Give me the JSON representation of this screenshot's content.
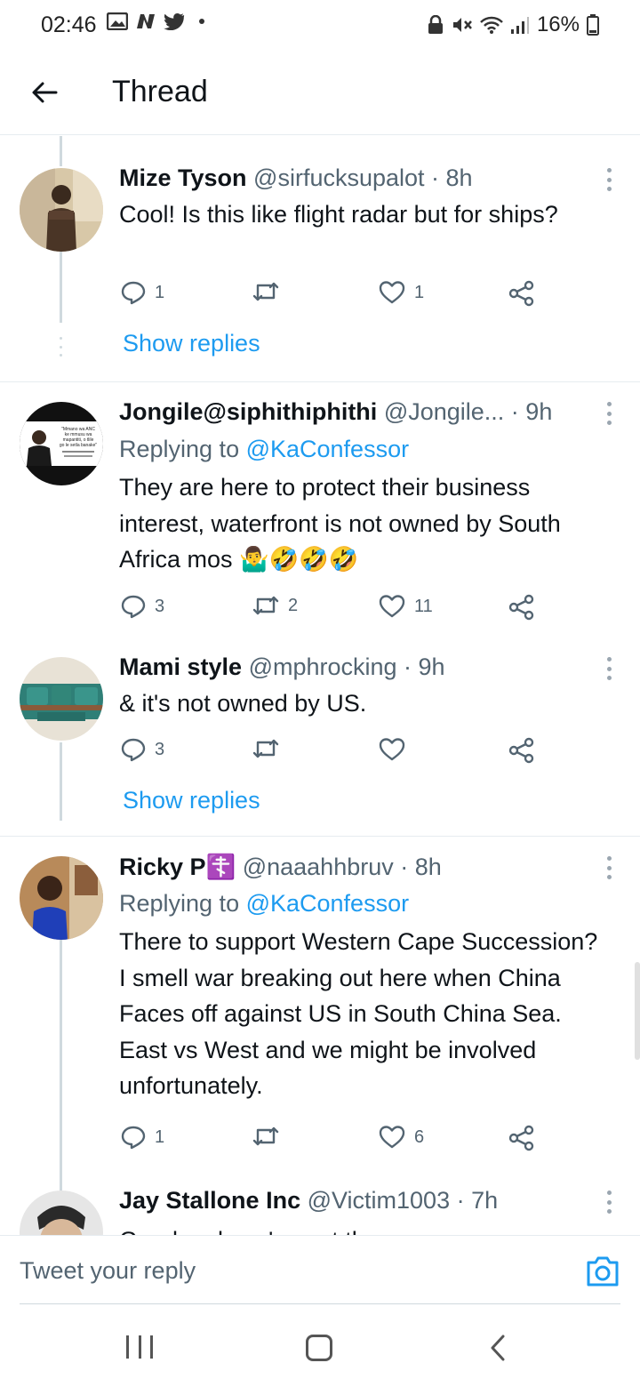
{
  "status_bar": {
    "time": "02:46",
    "battery": "16%",
    "left_icons": [
      "gallery-icon",
      "n-icon",
      "twitter-icon",
      "dot-icon"
    ],
    "right_icons": [
      "lock-icon",
      "mute-icon",
      "wifi-icon",
      "signal-icon",
      "battery-icon"
    ]
  },
  "header": {
    "title": "Thread",
    "back_icon": "arrow-left-icon"
  },
  "tweets": [
    {
      "name": "Mize Tyson",
      "meta": "@sirfucksupalot · 8h",
      "replying_label": "",
      "replying_to": "",
      "text": "Cool! Is this like flight radar but for ships?",
      "replies": "1",
      "retweets": "",
      "likes": "1",
      "show_replies": "Show replies"
    },
    {
      "name": "Jongile@siphithiphithi",
      "meta": "@Jongile... · 9h",
      "replying_label": "Replying to ",
      "replying_to": "@KaConfessor",
      "text": "They are here to protect their business interest, waterfront is not owned by South Africa mos 🤷‍♂️🤣🤣🤣",
      "replies": "3",
      "retweets": "2",
      "likes": "11",
      "avatar_text": "\"Mmano wa ANC ke mmusu wa mapantiti, o tlile go le setla banake\""
    },
    {
      "name": "Mami style",
      "meta": "@mphrocking · 9h",
      "text": "& it's not owned by US.",
      "replies": "3",
      "retweets": "",
      "likes": "",
      "show_replies": "Show replies"
    },
    {
      "name": "Ricky P☦️",
      "meta": "@naaahhbruv · 8h",
      "replying_label": "Replying to ",
      "replying_to": "@KaConfessor",
      "text": "There to support Western Cape Succession? I smell war breaking out here when China Faces off against US in South China Sea. East vs West and we might be involved unfortunately.",
      "replies": "1",
      "retweets": "",
      "likes": "6"
    },
    {
      "name": "Jay Stallone Inc",
      "meta": "@Victim1003 · 7h",
      "text": "Good zarl you've got there..."
    }
  ],
  "reply_bar": {
    "placeholder": "Tweet your reply",
    "camera_icon": "camera-icon"
  },
  "nav_bar": {
    "icons": [
      "recent-apps-icon",
      "home-icon",
      "back-icon"
    ]
  },
  "colors": {
    "accent": "#1d9bf0",
    "text": "#0f1419",
    "muted": "#536471",
    "divider": "#e6ecf0"
  }
}
